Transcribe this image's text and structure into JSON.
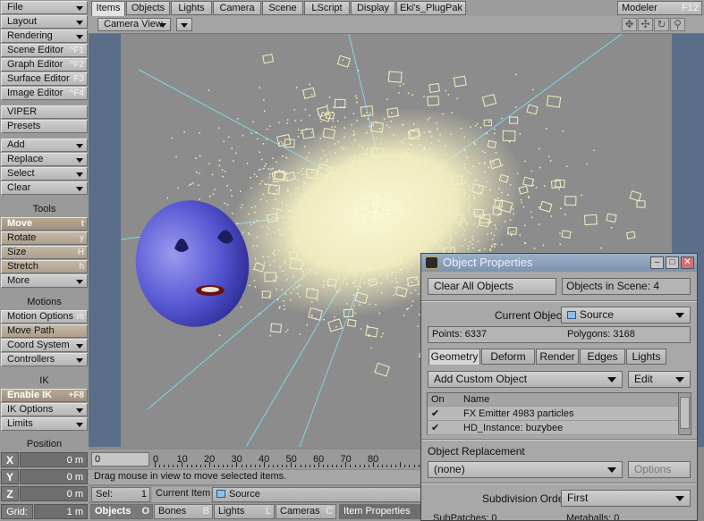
{
  "colors": {
    "viewport_bg": "#8c8c8c",
    "viewport_margin": "#5a6e8a",
    "particles": "#f3f0c0",
    "guide_lines": "#7fd6e8",
    "head": "#5a5ad6",
    "title_bar": "#8da2bc"
  },
  "left_toolbar": {
    "menus_top": [
      {
        "label": "File",
        "shortcut": ""
      },
      {
        "label": "Layout",
        "shortcut": ""
      },
      {
        "label": "Rendering",
        "shortcut": ""
      },
      {
        "label": "Scene Editor",
        "shortcut": "^F1"
      },
      {
        "label": "Graph Editor",
        "shortcut": "^F2"
      },
      {
        "label": "Surface Editor",
        "shortcut": "F3"
      },
      {
        "label": "Image Editor",
        "shortcut": "^F4"
      }
    ],
    "viper": "VIPER",
    "presets": "Presets",
    "menus_mid": [
      {
        "label": "Add"
      },
      {
        "label": "Replace"
      },
      {
        "label": "Select"
      },
      {
        "label": "Clear"
      }
    ],
    "tools_header": "Tools",
    "tools": [
      {
        "label": "Move",
        "shortcut": "t"
      },
      {
        "label": "Rotate",
        "shortcut": "y"
      },
      {
        "label": "Size",
        "shortcut": "H"
      },
      {
        "label": "Stretch",
        "shortcut": "h"
      },
      {
        "label": "More",
        "shortcut": ""
      }
    ],
    "motions_header": "Motions",
    "motions": [
      {
        "label": "Motion Options",
        "shortcut": "m"
      },
      {
        "label": "Move Path",
        "shortcut": ""
      },
      {
        "label": "Coord System",
        "shortcut": ""
      },
      {
        "label": "Controllers",
        "shortcut": ""
      }
    ],
    "ik_header": "IK",
    "ik": [
      {
        "label": "Enable IK",
        "shortcut": "+F8"
      },
      {
        "label": "IK Options",
        "shortcut": ""
      },
      {
        "label": "Limits",
        "shortcut": ""
      }
    ],
    "position_header": "Position",
    "position": [
      {
        "axis": "X",
        "value": "0 m"
      },
      {
        "axis": "Y",
        "value": "0 m"
      },
      {
        "axis": "Z",
        "value": "0 m"
      }
    ],
    "grid_label": "Grid:",
    "grid_value": "1 m"
  },
  "tabs": [
    "Items",
    "Objects",
    "Lights",
    "Camera",
    "Scene",
    "LScript",
    "Display",
    "Eki's_PlugPak"
  ],
  "modeler": {
    "label": "Modeler",
    "shortcut": "F12"
  },
  "viewport": {
    "view_label": "Camera View"
  },
  "timeline": {
    "current_frame": "0",
    "ticks": [
      "0",
      "10",
      "20",
      "30",
      "40",
      "50",
      "60",
      "70",
      "80"
    ]
  },
  "status_text": "Drag mouse in view to move selected items.",
  "selbar": {
    "sel_label": "Sel:",
    "sel_count": "1",
    "current_item_label": "Current Item",
    "current_item_value": "Source"
  },
  "bottom_tabs": [
    {
      "label": "Objects",
      "shortcut": "O"
    },
    {
      "label": "Bones",
      "shortcut": "B"
    },
    {
      "label": "Lights",
      "shortcut": "L"
    },
    {
      "label": "Cameras",
      "shortcut": "C"
    },
    {
      "label": "Item Properties",
      "shortcut": ""
    }
  ],
  "dialog": {
    "title": "Object Properties",
    "clear_all": "Clear All Objects",
    "objects_in_scene": "Objects in Scene: 4",
    "current_object_label": "Current Object",
    "current_object_value": "Source",
    "points": "Points: 6337",
    "polygons": "Polygons: 3168",
    "tabs": [
      "Geometry",
      "Deform",
      "Render",
      "Edges",
      "Lights"
    ],
    "add_custom": "Add Custom Object",
    "edit": "Edit",
    "list_headers": {
      "on": "On",
      "name": "Name"
    },
    "list_rows": [
      {
        "on": "✔",
        "name": "FX Emitter 4983 particles"
      },
      {
        "on": "✔",
        "name": "HD_Instance: buzybee"
      }
    ],
    "replacement_label": "Object Replacement",
    "replacement_value": "(none)",
    "options": "Options",
    "subdiv_label": "Subdivision Order",
    "subdiv_value": "First",
    "subpatches": "SubPatches: 0",
    "metaballs": "Metaballs: 0"
  }
}
